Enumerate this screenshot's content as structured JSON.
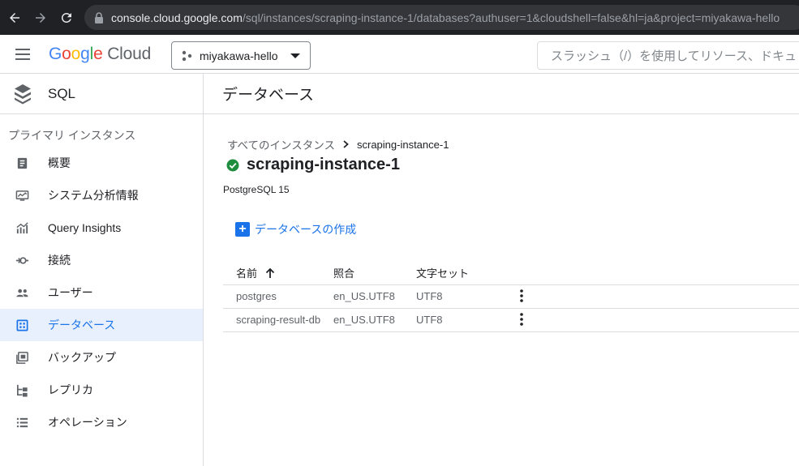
{
  "browser": {
    "url_host": "console.cloud.google.com",
    "url_path": "/sql/instances/scraping-instance-1/databases?authuser=1&cloudshell=false&hl=ja&project=miyakawa-hello"
  },
  "header": {
    "logo_letters": [
      "G",
      "o",
      "o",
      "g",
      "l",
      "e"
    ],
    "logo_cloud": "Cloud",
    "project_name": "miyakawa-hello",
    "search_placeholder": "スラッシュ（/）を使用してリソース、ドキュ"
  },
  "sidebar": {
    "product_title": "SQL",
    "section_label": "プライマリ インスタンス",
    "items": [
      {
        "label": "概要",
        "icon": "overview-icon"
      },
      {
        "label": "システム分析情報",
        "icon": "system-insights-icon"
      },
      {
        "label": "Query Insights",
        "icon": "query-insights-icon"
      },
      {
        "label": "接続",
        "icon": "connections-icon"
      },
      {
        "label": "ユーザー",
        "icon": "users-icon"
      },
      {
        "label": "データベース",
        "icon": "databases-icon",
        "active": true
      },
      {
        "label": "バックアップ",
        "icon": "backups-icon"
      },
      {
        "label": "レプリカ",
        "icon": "replicas-icon"
      },
      {
        "label": "オペレーション",
        "icon": "operations-icon"
      }
    ]
  },
  "main": {
    "page_title": "データベース",
    "breadcrumb": {
      "parent": "すべてのインスタンス",
      "current": "scraping-instance-1"
    },
    "instance_name": "scraping-instance-1",
    "instance_status": "running",
    "db_version": "PostgreSQL 15",
    "create_button": "データベースの作成",
    "table": {
      "headers": [
        "名前",
        "照合",
        "文字セット"
      ],
      "sort": "ascending",
      "rows": [
        {
          "name": "postgres",
          "collation": "en_US.UTF8",
          "charset": "UTF8"
        },
        {
          "name": "scraping-result-db",
          "collation": "en_US.UTF8",
          "charset": "UTF8"
        }
      ]
    }
  },
  "colors": {
    "accent": "#1a73e8",
    "success": "#1e8e3e",
    "active_bg": "#e8f0fe"
  }
}
